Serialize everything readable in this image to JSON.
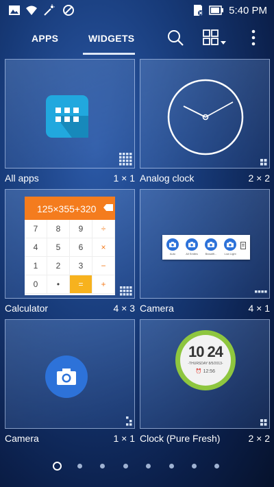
{
  "status_bar": {
    "time": "5:40 PM",
    "icons": [
      "image-icon",
      "wifi-icon",
      "magic-wand-icon",
      "no-disturb-icon",
      "sd-card-icon",
      "battery-icon"
    ]
  },
  "top_bar": {
    "tabs": [
      {
        "label": "APPS",
        "selected": false
      },
      {
        "label": "WIDGETS",
        "selected": true
      }
    ],
    "icons": [
      "search-icon",
      "grid-view-icon",
      "more-vert-icon"
    ]
  },
  "widgets": [
    {
      "name": "All apps",
      "size": "1 × 1"
    },
    {
      "name": "Analog clock",
      "size": "2 × 2"
    },
    {
      "name": "Calculator",
      "size": "4 × 3",
      "display": "125×355+320",
      "keys": [
        "7",
        "8",
        "9",
        "÷",
        "4",
        "5",
        "6",
        "×",
        "1",
        "2",
        "3",
        "−",
        "0",
        "•",
        "=",
        "+"
      ]
    },
    {
      "name": "Camera",
      "size": "4 × 1",
      "modes": [
        "Auto",
        "All Smiles",
        "Beautifi...",
        "Low Light"
      ]
    },
    {
      "name": "Camera",
      "size": "1 × 1"
    },
    {
      "name": "Clock (Pure Fresh)",
      "size": "2 × 2",
      "time": "10 24",
      "date": "-THURSDAY 8/5/2013-",
      "alarm": "12:56"
    }
  ],
  "pager": {
    "pages": 8,
    "current": 1
  },
  "colors": {
    "accent": "#f47c1e",
    "camera_blue": "#2d72d9",
    "fresh_green": "#8ec63f"
  }
}
